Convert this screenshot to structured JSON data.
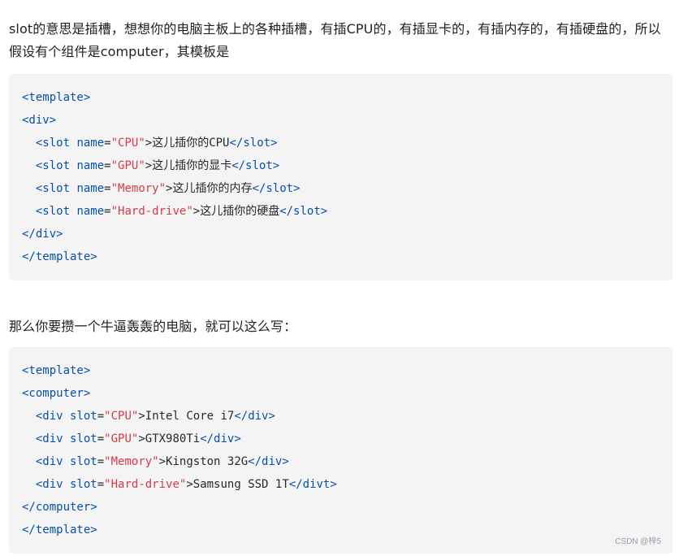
{
  "paragraph1": "slot的意思是插槽，想想你的电脑主板上的各种插槽，有插CPU的，有插显卡的，有插内存的，有插硬盘的，所以假设有个组件是computer，其模板是",
  "paragraph2": "那么你要攒一个牛逼轰轰的电脑，就可以这么写：",
  "code1": {
    "open_template": "<template>",
    "open_div": "<div>",
    "slot_open": "<slot",
    "attr_name": "name",
    "eq": "=",
    "gt": ">",
    "slot_close": "</slot>",
    "rows": [
      {
        "value": "\"CPU\"",
        "text": "这儿插你的CPU"
      },
      {
        "value": "\"GPU\"",
        "text": "这儿插你的显卡"
      },
      {
        "value": "\"Memory\"",
        "text": "这儿插你的内存"
      },
      {
        "value": "\"Hard-drive\"",
        "text": "这儿插你的硬盘"
      }
    ],
    "close_div": "</div>",
    "close_template": "</template>"
  },
  "code2": {
    "open_template": "<template>",
    "open_computer": "<computer>",
    "div_open": "<div",
    "attr_slot": "slot",
    "eq": "=",
    "gt": ">",
    "rows": [
      {
        "value": "\"CPU\"",
        "text": "Intel Core i7",
        "close": "</div>"
      },
      {
        "value": "\"GPU\"",
        "text": "GTX980Ti",
        "close": "</div>"
      },
      {
        "value": "\"Memory\"",
        "text": "Kingston 32G",
        "close": "</div>"
      },
      {
        "value": "\"Hard-drive\"",
        "text": "Samsung SSD 1T",
        "close": "</divt>"
      }
    ],
    "close_computer": "</computer>",
    "close_template": "</template>"
  },
  "watermark": "CSDN @梓5"
}
